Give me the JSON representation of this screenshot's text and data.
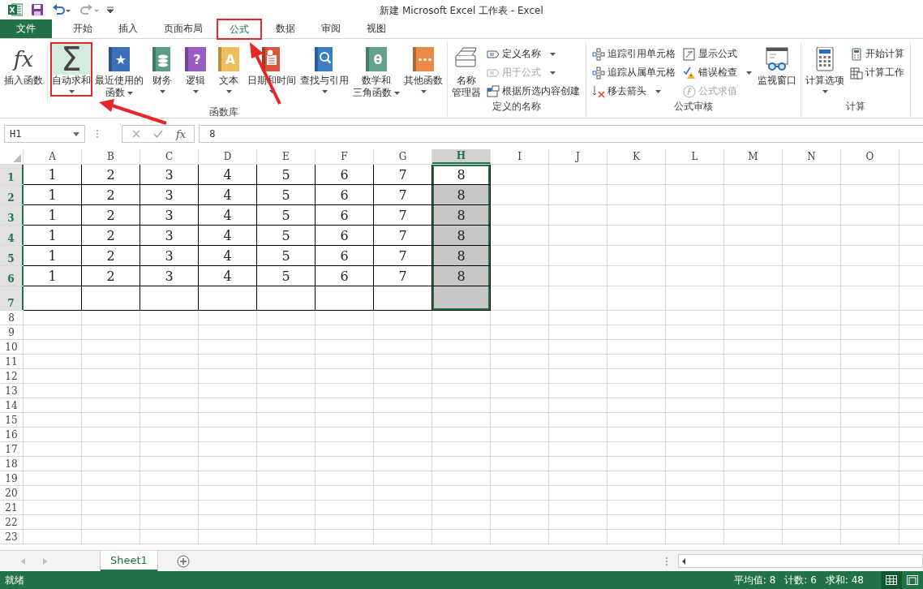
{
  "title_bar": {
    "title": "新建 Microsoft Excel 工作表 - Excel"
  },
  "tabs": [
    {
      "label": "文件",
      "kind": "file",
      "selected": false,
      "marked": false
    },
    {
      "label": "开始",
      "kind": "tab",
      "selected": false,
      "marked": false
    },
    {
      "label": "插入",
      "kind": "tab",
      "selected": false,
      "marked": false
    },
    {
      "label": "页面布局",
      "kind": "tab",
      "selected": false,
      "marked": false
    },
    {
      "label": "公式",
      "kind": "tab",
      "selected": true,
      "marked": true
    },
    {
      "label": "数据",
      "kind": "tab",
      "selected": false,
      "marked": false
    },
    {
      "label": "审阅",
      "kind": "tab",
      "selected": false,
      "marked": false
    },
    {
      "label": "视图",
      "kind": "tab",
      "selected": false,
      "marked": false
    }
  ],
  "ribbon": {
    "groups": [
      {
        "label": "函数库",
        "items": [
          {
            "kind": "large",
            "lines": [
              "插入函数"
            ],
            "glyph": "fx",
            "dropdown": false,
            "marked": false
          },
          {
            "kind": "large",
            "lines": [
              "自动求和"
            ],
            "glyph": "Σ",
            "dropdown": true,
            "marked": true
          },
          {
            "kind": "large",
            "lines": [
              "最近使用的",
              "函数"
            ],
            "glyph": "★",
            "dropdown": true,
            "marked": false
          },
          {
            "kind": "large",
            "lines": [
              "财务"
            ],
            "dropdown": true,
            "marked": false
          },
          {
            "kind": "large",
            "lines": [
              "逻辑"
            ],
            "glyph": "?",
            "dropdown": true,
            "marked": false
          },
          {
            "kind": "large",
            "lines": [
              "文本"
            ],
            "glyph": "A",
            "dropdown": true,
            "marked": false
          },
          {
            "kind": "large",
            "lines": [
              "日期和时间"
            ],
            "dropdown": true,
            "marked": false
          },
          {
            "kind": "large",
            "lines": [
              "查找与引用"
            ],
            "dropdown": true,
            "marked": false
          },
          {
            "kind": "large",
            "lines": [
              "数学和",
              "三角函数"
            ],
            "glyph": "θ",
            "dropdown": true,
            "marked": false
          },
          {
            "kind": "large",
            "lines": [
              "其他函数"
            ],
            "glyph": "···",
            "dropdown": true,
            "marked": false
          }
        ]
      },
      {
        "label": "定义的名称",
        "items": [
          {
            "kind": "large",
            "lines": [
              "名称",
              "管理器"
            ],
            "dropdown": false,
            "marked": false
          },
          {
            "kind": "stack",
            "items": [
              {
                "label": "定义名称",
                "dropdown": true,
                "disabled": false
              },
              {
                "label": "用于公式",
                "dropdown": true,
                "disabled": true
              },
              {
                "label": "根据所选内容创建",
                "dropdown": false,
                "disabled": false
              }
            ]
          }
        ]
      },
      {
        "label": "公式审核",
        "items": [
          {
            "kind": "stack",
            "items": [
              {
                "label": "追踪引用单元格",
                "dropdown": false,
                "disabled": false
              },
              {
                "label": "追踪从属单元格",
                "dropdown": false,
                "disabled": false
              },
              {
                "label": "移去箭头",
                "dropdown": true,
                "disabled": false
              }
            ]
          },
          {
            "kind": "stack",
            "items": [
              {
                "label": "显示公式",
                "dropdown": false,
                "disabled": false
              },
              {
                "label": "错误检查",
                "dropdown": true,
                "disabled": false
              },
              {
                "label": "公式求值",
                "dropdown": false,
                "disabled": true
              }
            ]
          },
          {
            "kind": "large",
            "lines": [
              "监视窗口"
            ],
            "dropdown": false,
            "marked": false
          }
        ]
      },
      {
        "label": "计算",
        "items": [
          {
            "kind": "large",
            "lines": [
              "计算选项"
            ],
            "dropdown": true,
            "marked": false
          },
          {
            "kind": "stack",
            "items": [
              {
                "label": "开始计算",
                "dropdown": false,
                "disabled": false
              },
              {
                "label": "计算工作",
                "dropdown": false,
                "disabled": false
              }
            ]
          }
        ]
      }
    ]
  },
  "formula_bar": {
    "name_box": "H1",
    "fx": "fx",
    "formula": "8"
  },
  "sheet": {
    "columns": [
      {
        "label": "A",
        "selected": false
      },
      {
        "label": "B",
        "selected": false
      },
      {
        "label": "C",
        "selected": false
      },
      {
        "label": "D",
        "selected": false
      },
      {
        "label": "E",
        "selected": false
      },
      {
        "label": "F",
        "selected": false
      },
      {
        "label": "G",
        "selected": false
      },
      {
        "label": "H",
        "selected": true
      },
      {
        "label": "I",
        "selected": false
      },
      {
        "label": "J",
        "selected": false
      },
      {
        "label": "K",
        "selected": false
      },
      {
        "label": "L",
        "selected": false
      },
      {
        "label": "M",
        "selected": false
      },
      {
        "label": "N",
        "selected": false
      },
      {
        "label": "O",
        "selected": false
      }
    ],
    "rows": [
      {
        "label": "1",
        "selected": true,
        "bordered": true,
        "cells": [
          "1",
          "2",
          "3",
          "4",
          "5",
          "6",
          "7",
          "8"
        ]
      },
      {
        "label": "2",
        "selected": true,
        "bordered": true,
        "cells": [
          "1",
          "2",
          "3",
          "4",
          "5",
          "6",
          "7",
          "8"
        ]
      },
      {
        "label": "3",
        "selected": true,
        "bordered": true,
        "cells": [
          "1",
          "2",
          "3",
          "4",
          "5",
          "6",
          "7",
          "8"
        ]
      },
      {
        "label": "4",
        "selected": true,
        "bordered": true,
        "cells": [
          "1",
          "2",
          "3",
          "4",
          "5",
          "6",
          "7",
          "8"
        ]
      },
      {
        "label": "5",
        "selected": true,
        "bordered": true,
        "cells": [
          "1",
          "2",
          "3",
          "4",
          "5",
          "6",
          "7",
          "8"
        ]
      },
      {
        "label": "6",
        "selected": true,
        "bordered": true,
        "cells": [
          "1",
          "2",
          "3",
          "4",
          "5",
          "6",
          "7",
          "8"
        ]
      },
      {
        "label": "7",
        "selected": true,
        "bordered": true
      },
      {
        "label": "8",
        "selected": false,
        "bordered": false
      },
      {
        "label": "9",
        "selected": false,
        "bordered": false
      },
      {
        "label": "10",
        "selected": false,
        "bordered": false
      },
      {
        "label": "11",
        "selected": false,
        "bordered": false
      },
      {
        "label": "12",
        "selected": false,
        "bordered": false
      },
      {
        "label": "13",
        "selected": false,
        "bordered": false
      },
      {
        "label": "14",
        "selected": false,
        "bordered": false
      },
      {
        "label": "15",
        "selected": false,
        "bordered": false
      },
      {
        "label": "16",
        "selected": false,
        "bordered": false
      },
      {
        "label": "17",
        "selected": false,
        "bordered": false
      },
      {
        "label": "18",
        "selected": false,
        "bordered": false
      },
      {
        "label": "19",
        "selected": false,
        "bordered": false
      },
      {
        "label": "20",
        "selected": false,
        "bordered": false
      },
      {
        "label": "21",
        "selected": false,
        "bordered": false
      },
      {
        "label": "22",
        "selected": false,
        "bordered": false
      },
      {
        "label": "23",
        "selected": false,
        "bordered": false
      }
    ]
  },
  "sheet_tabs": [
    {
      "label": "Sheet1",
      "selected": true
    }
  ],
  "status_bar": {
    "status": "就绪",
    "stats": [
      "平均值: 8",
      "计数: 6",
      "求和: 48"
    ]
  }
}
